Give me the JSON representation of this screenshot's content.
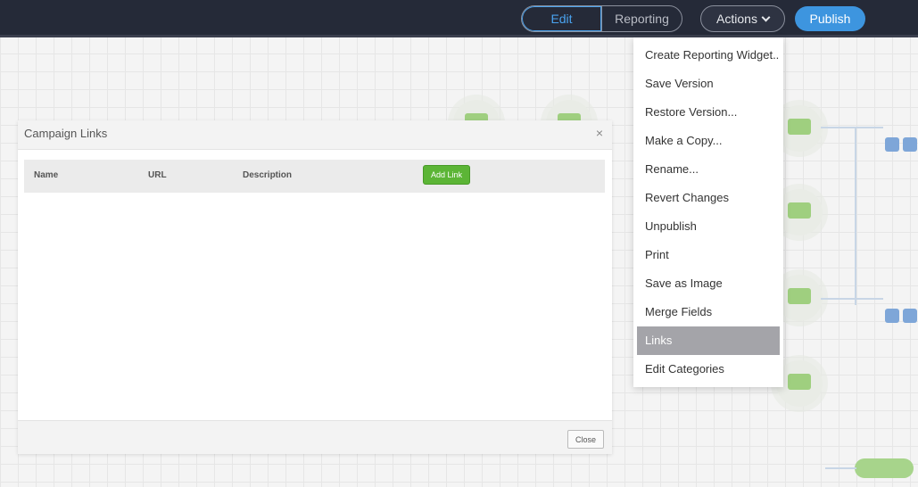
{
  "topbar": {
    "edit_label": "Edit",
    "reporting_label": "Reporting",
    "actions_label": "Actions",
    "publish_label": "Publish"
  },
  "actions_menu": {
    "items": [
      "Create Reporting Widget...",
      "Save Version",
      "Restore Version...",
      "Make a Copy...",
      "Rename...",
      "Revert Changes",
      "Unpublish",
      "Print",
      "Save as Image",
      "Merge Fields",
      "Links",
      "Edit Categories"
    ],
    "active_item": "Links"
  },
  "modal": {
    "title": "Campaign Links",
    "close_x": "×",
    "columns": {
      "name": "Name",
      "url": "URL",
      "description": "Description"
    },
    "add_link_label": "Add Link",
    "close_label": "Close"
  },
  "colors": {
    "topbar_bg": "#252a38",
    "accent_blue": "#3d95df",
    "add_link_green": "#5cb536",
    "menu_active": "#a4a4a9"
  }
}
